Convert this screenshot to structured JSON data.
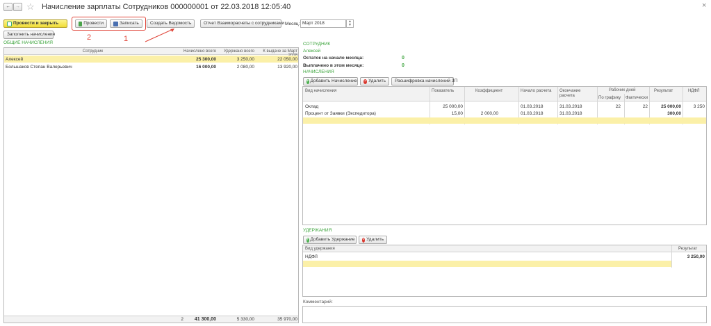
{
  "window": {
    "title": "Начисление зарплаты Сотрудников 000000001 от 22.03.2018 12:05:40",
    "back": "←",
    "forward": "→",
    "star": "☆",
    "close": "×"
  },
  "toolbar": {
    "post_close": "Провести и закрыть",
    "post": "Провести",
    "save": "Записать",
    "create_statement": "Создать Ведомость",
    "report": "Отчет Взаиморасчеты с сотрудниками",
    "month_label": "Месяц:",
    "month_value": "Март 2018",
    "fill": "Заполнить начисления"
  },
  "annotations": {
    "one": "1",
    "two": "2"
  },
  "left": {
    "section": "ОБЩИЕ НАЧИСЛЕНИЯ",
    "columns": [
      "Сотрудник",
      "Начислено всего",
      "Удержано всего",
      "К выдаче за Март 2018"
    ],
    "rows": [
      {
        "name": "Алексей",
        "accrued": "25 300,00",
        "withheld": "3 250,00",
        "payout": "22 050,00"
      },
      {
        "name": "Большаков Степан Валерьевич",
        "accrued": "16 000,00",
        "withheld": "2 080,00",
        "payout": "13 920,00"
      }
    ],
    "footer": {
      "count": "2",
      "accrued": "41 300,00",
      "withheld": "5 330,00",
      "payout": "35 970,00"
    }
  },
  "employee": {
    "section": "СОТРУДНИК",
    "name": "Алексей",
    "start_balance_label": "Остаток на начало месяца:",
    "start_balance": "0",
    "paid_label": "Выплачено в этом месяце:",
    "paid": "0"
  },
  "accruals": {
    "section": "НАЧИСЛЕНИЯ",
    "add": "Добавить Начисление",
    "delete": "Удалить",
    "breakdown": "Расшифровка начислений ЗП",
    "columns": {
      "type": "Вид начисления",
      "indicator": "Показатель",
      "coef": "Коэффициент",
      "start": "Начало расчета",
      "end": "Окончание расчета",
      "workdays": "Рабочих дней",
      "sched": "По графику",
      "fact": "Фактически",
      "result": "Результат",
      "ndfl": "НДФЛ"
    },
    "rows": [
      {
        "type": "Оклад",
        "indicator": "25 000,00",
        "coef": "",
        "start": "01.03.2018",
        "end": "31.03.2018",
        "sched": "22",
        "fact": "22",
        "result": "25 000,00",
        "ndfl": "3 250"
      },
      {
        "type": "Процент от Заявки (Экспедитора)",
        "indicator": "15,00",
        "coef": "2 000,00",
        "start": "01.03.2018",
        "end": "31.03.2018",
        "sched": "",
        "fact": "",
        "result": "300,00",
        "ndfl": ""
      }
    ]
  },
  "deductions": {
    "section": "УДЕРЖАНИЯ",
    "add": "Добавить Удержание",
    "delete": "Удалить",
    "columns": {
      "type": "Вид удержания",
      "result": "Результат"
    },
    "rows": [
      {
        "type": "НДФЛ",
        "result": "3 250,00"
      }
    ]
  },
  "comment": {
    "label": "Комментарий:"
  }
}
